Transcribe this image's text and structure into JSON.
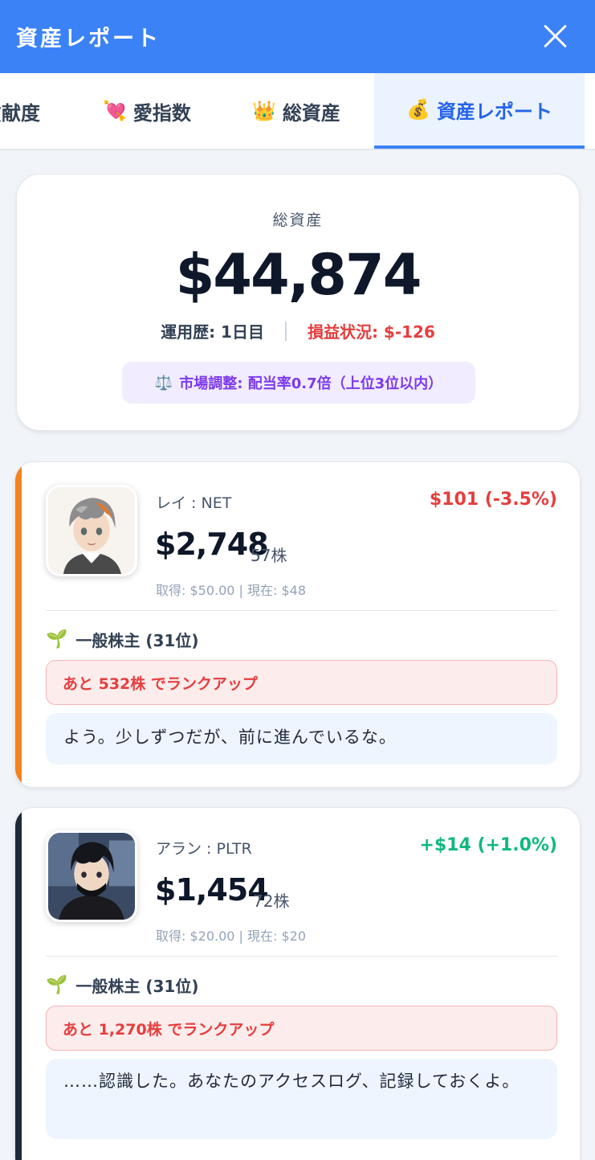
{
  "header": {
    "title": "資産レポート",
    "close_icon": "close-icon"
  },
  "tabs": [
    {
      "emoji": "",
      "label": "貢献度"
    },
    {
      "emoji": "💘",
      "label": "愛指数"
    },
    {
      "emoji": "👑",
      "label": "総資産"
    },
    {
      "emoji": "💰",
      "label": "資産レポート",
      "active": true
    }
  ],
  "summary": {
    "label": "総資産",
    "total": "$44,874",
    "history": "運用歴: 1日目",
    "pnl": "損益状況: $-126",
    "market_icon": "⚖️",
    "market_text": "市場調整: 配当率0.7倍（上位3位以内）"
  },
  "stocks": [
    {
      "name": "レイ : NET",
      "change": "$101 (-3.5%)",
      "direction": "negative",
      "price": "$2,748",
      "shares": "57株",
      "cost": "取得: $50.00 | 現在: $48",
      "rank_icon": "🌱",
      "rank": "一般株主 (31位)",
      "rankup": "あと 532株 でランクアップ",
      "quote": "よう。少しずつだが、前に進んでいるな。",
      "accent": "#f5821f"
    },
    {
      "name": "アラン : PLTR",
      "change": "+$14 (+1.0%)",
      "direction": "positive",
      "price": "$1,454",
      "shares": "72株",
      "cost": "取得: $20.00 | 現在: $20",
      "rank_icon": "🌱",
      "rank": "一般株主 (31位)",
      "rankup": "あと 1,270株 でランクアップ",
      "quote": "……認識した。あなたのアクセスログ、記録しておくよ。",
      "accent": "#1e293b"
    }
  ]
}
